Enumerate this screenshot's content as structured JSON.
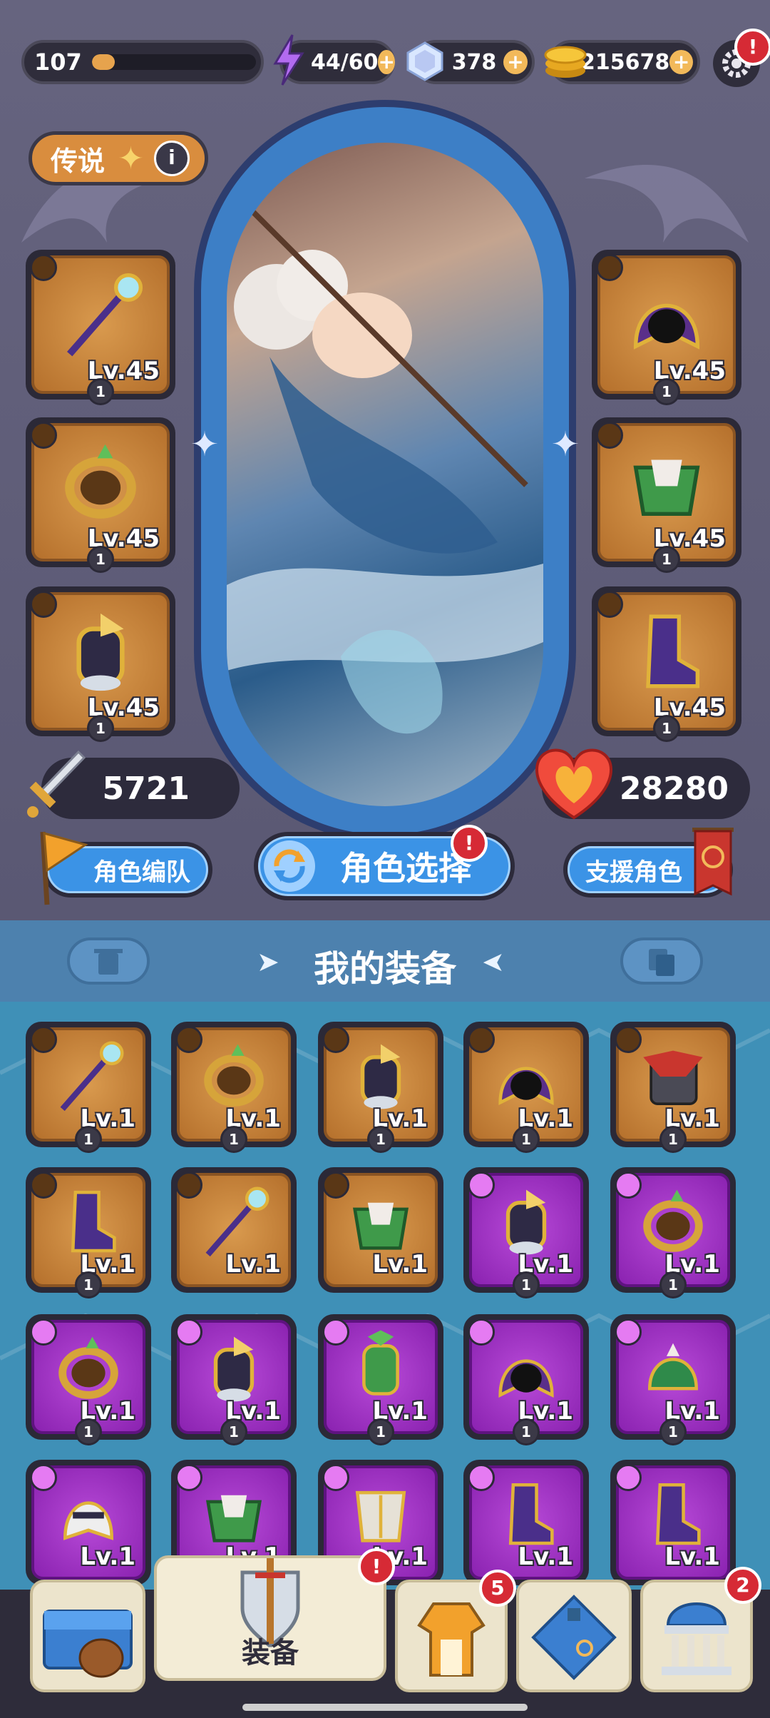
{
  "status_bar": {
    "level": "107",
    "level_progress": 0.14,
    "energy": "44/60",
    "gems": "378",
    "gold": "215678",
    "plus": "+",
    "settings_alert": "!"
  },
  "rarity_tag": {
    "label": "传说",
    "info": "i"
  },
  "left_slots": [
    {
      "icon": "staff-icon",
      "level": "Lv.45",
      "count": "1"
    },
    {
      "icon": "ring-icon",
      "level": "Lv.45",
      "count": "1"
    },
    {
      "icon": "bracer-icon",
      "level": "Lv.45",
      "count": "1"
    }
  ],
  "right_slots": [
    {
      "icon": "hood-icon",
      "level": "Lv.45",
      "count": "1"
    },
    {
      "icon": "cloak-armor-icon",
      "level": "Lv.45",
      "count": "1"
    },
    {
      "icon": "boot-icon",
      "level": "Lv.45",
      "count": "1"
    }
  ],
  "stats": {
    "attack": "5721",
    "hp": "28280"
  },
  "buttons": {
    "team_label": "角色编队",
    "select_label": "角色选择",
    "select_alert": "!",
    "support_label": "支援角色"
  },
  "inventory": {
    "title": "我的装备",
    "items": [
      {
        "icon": "staff-icon",
        "rarity": "orange",
        "level": "Lv.1",
        "count": "1"
      },
      {
        "icon": "ring-icon",
        "rarity": "orange",
        "level": "Lv.1",
        "count": "1"
      },
      {
        "icon": "bracer-icon",
        "rarity": "orange",
        "level": "Lv.1",
        "count": "1"
      },
      {
        "icon": "hood-icon",
        "rarity": "orange",
        "level": "Lv.1",
        "count": "1"
      },
      {
        "icon": "spiked-armor-icon",
        "rarity": "orange",
        "level": "Lv.1",
        "count": "1"
      },
      {
        "icon": "boot-icon",
        "rarity": "orange",
        "level": "Lv.1",
        "count": "1"
      },
      {
        "icon": "staff-icon",
        "rarity": "orange",
        "level": "Lv.1",
        "count": ""
      },
      {
        "icon": "cloak-armor-icon",
        "rarity": "orange",
        "level": "Lv.1",
        "count": ""
      },
      {
        "icon": "bracer-icon",
        "rarity": "purple",
        "level": "Lv.1",
        "count": "1"
      },
      {
        "icon": "ring-icon",
        "rarity": "purple",
        "level": "Lv.1",
        "count": "1"
      },
      {
        "icon": "ring-icon",
        "rarity": "purple",
        "level": "Lv.1",
        "count": "1"
      },
      {
        "icon": "bracer-icon",
        "rarity": "purple",
        "level": "Lv.1",
        "count": "1"
      },
      {
        "icon": "gauntlet-icon",
        "rarity": "purple",
        "level": "Lv.1",
        "count": "1"
      },
      {
        "icon": "hood-icon",
        "rarity": "purple",
        "level": "Lv.1",
        "count": "1"
      },
      {
        "icon": "helmet-icon",
        "rarity": "purple",
        "level": "Lv.1",
        "count": "1"
      },
      {
        "icon": "helmet-mask-icon",
        "rarity": "purple",
        "level": "Lv.1",
        "count": ""
      },
      {
        "icon": "cloak-armor-icon",
        "rarity": "purple",
        "level": "Lv.1",
        "count": ""
      },
      {
        "icon": "breastplate-icon",
        "rarity": "purple",
        "level": "Lv.1",
        "count": ""
      },
      {
        "icon": "boot-icon",
        "rarity": "purple",
        "level": "Lv.1",
        "count": ""
      },
      {
        "icon": "boot-icon",
        "rarity": "purple",
        "level": "Lv.1",
        "count": ""
      }
    ]
  },
  "nav": {
    "equipment_label": "装备",
    "equipment_alert": "!",
    "outfit_badge": "5",
    "academy_badge": "2"
  },
  "colors": {
    "orange_slot": "#c07a34",
    "purple_slot": "#9a2dc3",
    "accent_blue": "#3b93e6"
  }
}
